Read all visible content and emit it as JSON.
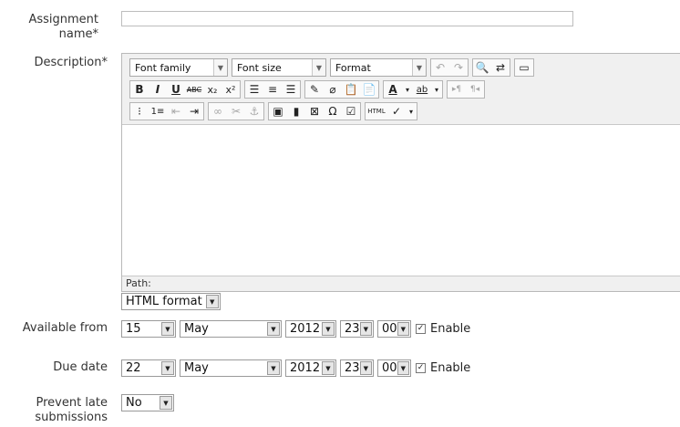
{
  "form": {
    "assignment_name_label": "Assignment name*",
    "assignment_name_value": "",
    "description_label": "Description*",
    "available_from_label": "Available from",
    "due_date_label": "Due date",
    "prevent_late_label": "Prevent late submissions"
  },
  "editor": {
    "font_family": "Font family",
    "font_size": "Font size",
    "format": "Format",
    "path_label": "Path:",
    "content": ""
  },
  "text_format": {
    "selected": "HTML format"
  },
  "available_from": {
    "day": "15",
    "month": "May",
    "year": "2012",
    "hour": "23",
    "minute": "00",
    "enabled": true,
    "enable_label": "Enable"
  },
  "due_date": {
    "day": "22",
    "month": "May",
    "year": "2012",
    "hour": "23",
    "minute": "00",
    "enabled": true,
    "enable_label": "Enable"
  },
  "prevent_late": {
    "selected": "No"
  },
  "icons": {
    "toolbar_row1": [
      "undo-icon",
      "redo-icon",
      "find-icon",
      "find-replace-icon",
      "fullscreen-icon"
    ],
    "toolbar_row2": [
      "bold-icon",
      "italic-icon",
      "underline-icon",
      "strikethrough-icon",
      "subscript-icon",
      "superscript-icon",
      "align-left-icon",
      "align-center-icon",
      "align-right-icon",
      "cleanup-icon",
      "remove-format-icon",
      "paste-text-icon",
      "paste-word-icon",
      "text-color-icon",
      "highlight-color-icon",
      "ltr-icon",
      "rtl-icon"
    ],
    "toolbar_row3": [
      "bullet-list-icon",
      "numbered-list-icon",
      "outdent-icon",
      "indent-icon",
      "link-icon",
      "unlink-icon",
      "anchor-icon",
      "image-icon",
      "media-icon",
      "nonbreaking-icon",
      "charmap-icon",
      "emoticon-icon",
      "html-icon",
      "spellcheck-icon"
    ]
  }
}
